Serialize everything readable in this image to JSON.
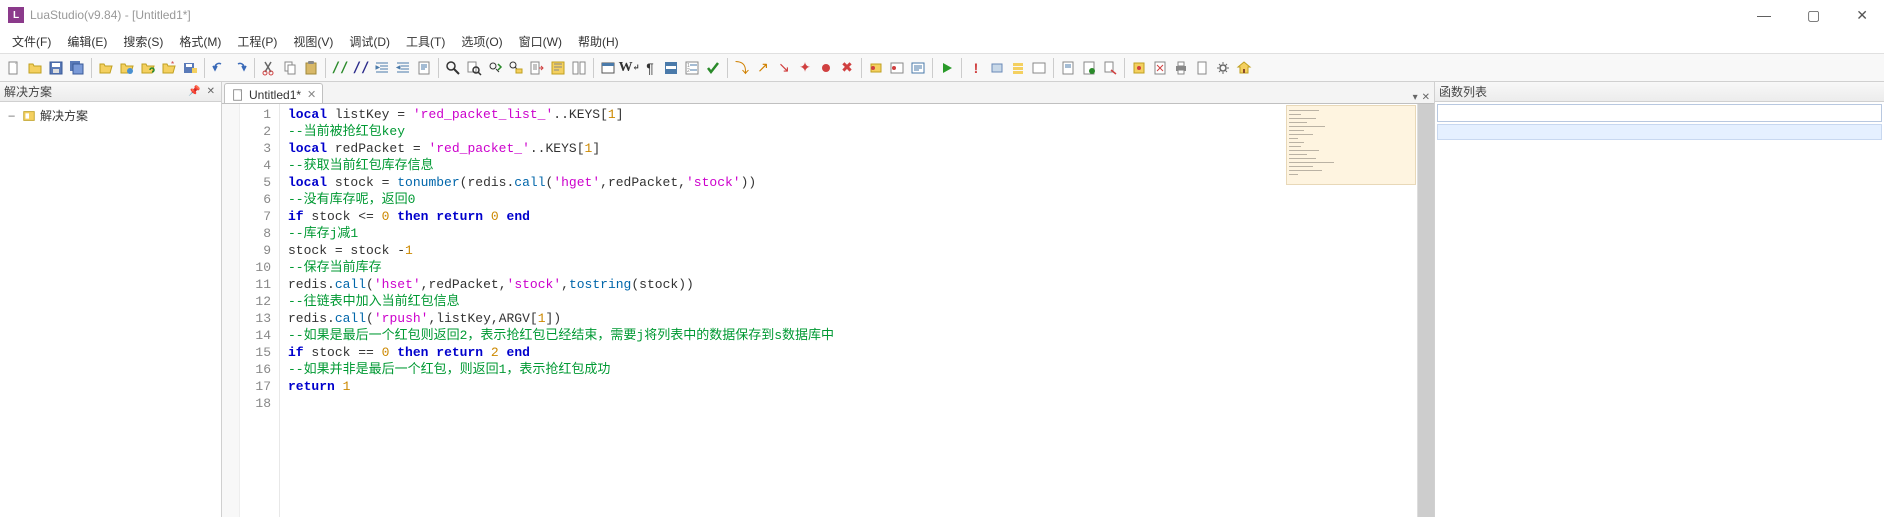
{
  "window": {
    "title": "LuaStudio(v9.84) - [Untitled1*]"
  },
  "menus": [
    "文件(F)",
    "编辑(E)",
    "搜索(S)",
    "格式(M)",
    "工程(P)",
    "视图(V)",
    "调试(D)",
    "工具(T)",
    "选项(O)",
    "窗口(W)",
    "帮助(H)"
  ],
  "panels": {
    "solution_title": "解决方案",
    "function_list_title": "函数列表"
  },
  "tree": {
    "root_label": "解决方案"
  },
  "tab": {
    "label": "Untitled1*"
  },
  "code_tokens": [
    [
      [
        "kw",
        "local"
      ],
      [
        "id",
        " listKey "
      ],
      [
        "punct",
        "= "
      ],
      [
        "str",
        "'red_packet_list_'"
      ],
      [
        "punct",
        ".."
      ],
      [
        "id",
        "KEYS"
      ],
      [
        "punct",
        "["
      ],
      [
        "num",
        "1"
      ],
      [
        "punct",
        "]"
      ]
    ],
    [
      [
        "com",
        "--当前被抢红包key"
      ]
    ],
    [
      [
        "kw",
        "local"
      ],
      [
        "id",
        " redPacket "
      ],
      [
        "punct",
        "= "
      ],
      [
        "str",
        "'red_packet_'"
      ],
      [
        "punct",
        ".."
      ],
      [
        "id",
        "KEYS"
      ],
      [
        "punct",
        "["
      ],
      [
        "num",
        "1"
      ],
      [
        "punct",
        "]"
      ]
    ],
    [
      [
        "com",
        "--获取当前红包库存信息"
      ]
    ],
    [
      [
        "kw",
        "local"
      ],
      [
        "id",
        " stock "
      ],
      [
        "punct",
        "= "
      ],
      [
        "fn",
        "tonumber"
      ],
      [
        "punct",
        "("
      ],
      [
        "id",
        "redis"
      ],
      [
        "punct",
        "."
      ],
      [
        "fn",
        "call"
      ],
      [
        "punct",
        "("
      ],
      [
        "str",
        "'hget'"
      ],
      [
        "punct",
        ","
      ],
      [
        "id",
        "redPacket"
      ],
      [
        "punct",
        ","
      ],
      [
        "str",
        "'stock'"
      ],
      [
        "punct",
        "))"
      ]
    ],
    [
      [
        "com",
        "--没有库存呢，返回0"
      ]
    ],
    [
      [
        "kw",
        "if"
      ],
      [
        "id",
        " stock "
      ],
      [
        "punct",
        "<= "
      ],
      [
        "num",
        "0"
      ],
      [
        "id",
        " "
      ],
      [
        "kw",
        "then"
      ],
      [
        "id",
        " "
      ],
      [
        "kw",
        "return"
      ],
      [
        "id",
        " "
      ],
      [
        "num",
        "0"
      ],
      [
        "id",
        " "
      ],
      [
        "kw",
        "end"
      ]
    ],
    [
      [
        "com",
        "--库存j减1"
      ]
    ],
    [
      [
        "id",
        "stock "
      ],
      [
        "punct",
        "= "
      ],
      [
        "id",
        "stock "
      ],
      [
        "punct",
        "-"
      ],
      [
        "num",
        "1"
      ]
    ],
    [
      [
        "com",
        "--保存当前库存"
      ]
    ],
    [
      [
        "id",
        "redis"
      ],
      [
        "punct",
        "."
      ],
      [
        "fn",
        "call"
      ],
      [
        "punct",
        "("
      ],
      [
        "str",
        "'hset'"
      ],
      [
        "punct",
        ","
      ],
      [
        "id",
        "redPacket"
      ],
      [
        "punct",
        ","
      ],
      [
        "str",
        "'stock'"
      ],
      [
        "punct",
        ","
      ],
      [
        "fn",
        "tostring"
      ],
      [
        "punct",
        "("
      ],
      [
        "id",
        "stock"
      ],
      [
        "punct",
        "))"
      ]
    ],
    [
      [
        "com",
        "--往链表中加入当前红包信息"
      ]
    ],
    [
      [
        "id",
        "redis"
      ],
      [
        "punct",
        "."
      ],
      [
        "fn",
        "call"
      ],
      [
        "punct",
        "("
      ],
      [
        "str",
        "'rpush'"
      ],
      [
        "punct",
        ","
      ],
      [
        "id",
        "listKey"
      ],
      [
        "punct",
        ","
      ],
      [
        "id",
        "ARGV"
      ],
      [
        "punct",
        "["
      ],
      [
        "num",
        "1"
      ],
      [
        "punct",
        "])"
      ]
    ],
    [
      [
        "com",
        "--如果是最后一个红包则返回2，表示抢红包已经结束，需要j将列表中的数据保存到s数据库中"
      ]
    ],
    [
      [
        "kw",
        "if"
      ],
      [
        "id",
        " stock "
      ],
      [
        "punct",
        "== "
      ],
      [
        "num",
        "0"
      ],
      [
        "id",
        " "
      ],
      [
        "kw",
        "then"
      ],
      [
        "id",
        " "
      ],
      [
        "kw",
        "return"
      ],
      [
        "id",
        " "
      ],
      [
        "num",
        "2"
      ],
      [
        "id",
        " "
      ],
      [
        "kw",
        "end"
      ]
    ],
    [
      [
        "com",
        "--如果并非是最后一个红包，则返回1，表示抢红包成功"
      ]
    ],
    [
      [
        "kw",
        "return"
      ],
      [
        "id",
        " "
      ],
      [
        "num",
        "1"
      ]
    ],
    []
  ],
  "line_count": 18
}
